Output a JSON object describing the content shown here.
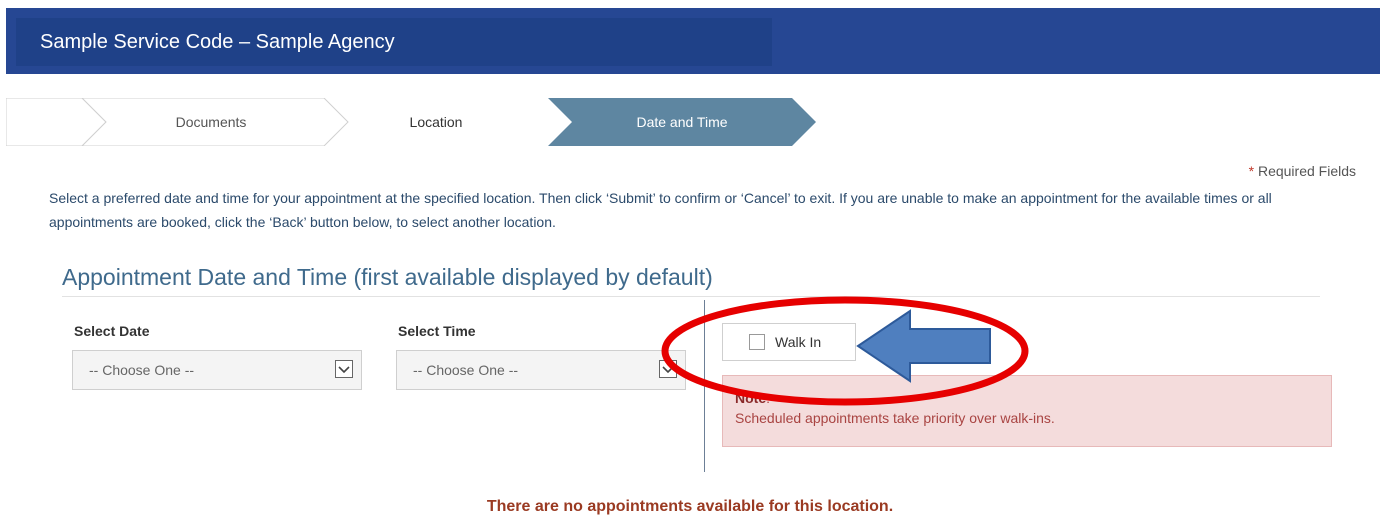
{
  "header": {
    "title": "Sample Service Code – Sample Agency"
  },
  "steps": [
    {
      "label": "Documents",
      "state": "completed"
    },
    {
      "label": "Location",
      "state": "completed"
    },
    {
      "label": "Date and Time",
      "state": "active"
    }
  ],
  "required_note": {
    "star": "*",
    "text": " Required Fields"
  },
  "intro": {
    "text": "Select a preferred date and time for your appointment at the specified location. Then click ‘Submit’ to confirm or ‘Cancel’ to exit. If you are unable to make an appointment for the available times or all appointments are booked, click the ‘Back’ button below, to select another location."
  },
  "section": {
    "title": "Appointment Date and Time (first available displayed by default)"
  },
  "date_field": {
    "label": "Select Date",
    "value": "-- Choose One --"
  },
  "time_field": {
    "label": "Select Time",
    "value": "-- Choose One --"
  },
  "walk_in": {
    "label": "Walk In",
    "checked": false
  },
  "note": {
    "heading": "Note",
    "suffix": ":",
    "body": "Scheduled appointments take priority over walk-ins."
  },
  "message": {
    "text": "There are no appointments available for this location."
  },
  "colors": {
    "header_bg": "#264793",
    "active_step": "#5e86a1",
    "annotation_ellipse": "#e60000",
    "annotation_arrow": "#4f7fbf"
  },
  "annotations": {
    "ellipse": "red-ellipse-around-walk-in",
    "arrow": "blue-arrow-pointing-left"
  }
}
